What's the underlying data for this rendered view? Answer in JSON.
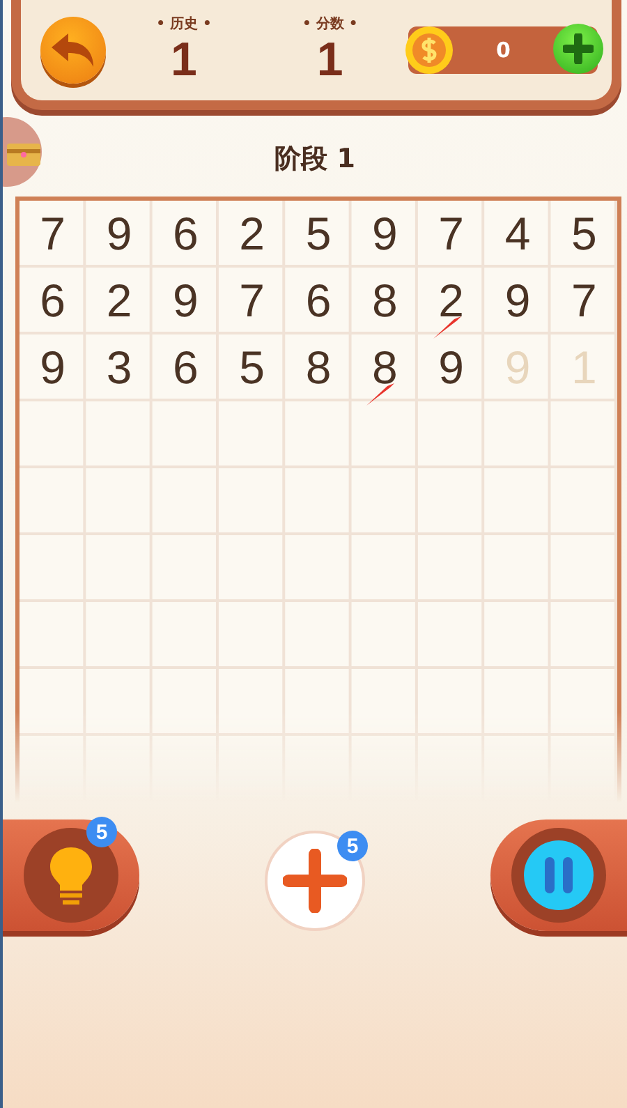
{
  "header": {
    "history": {
      "label": "• 历史 •",
      "value": "1"
    },
    "score": {
      "label": "• 分数 •",
      "value": "1"
    },
    "coins": "0"
  },
  "stage_title": "阶段 1",
  "board": {
    "cells": [
      {
        "digit": "7",
        "faded": false,
        "arrow": false
      },
      {
        "digit": "9",
        "faded": false,
        "arrow": false
      },
      {
        "digit": "6",
        "faded": false,
        "arrow": false
      },
      {
        "digit": "2",
        "faded": false,
        "arrow": false
      },
      {
        "digit": "5",
        "faded": false,
        "arrow": false
      },
      {
        "digit": "9",
        "faded": false,
        "arrow": false
      },
      {
        "digit": "7",
        "faded": false,
        "arrow": false
      },
      {
        "digit": "4",
        "faded": false,
        "arrow": false
      },
      {
        "digit": "5",
        "faded": false,
        "arrow": false
      },
      {
        "digit": "6",
        "faded": false,
        "arrow": false
      },
      {
        "digit": "2",
        "faded": false,
        "arrow": false
      },
      {
        "digit": "9",
        "faded": false,
        "arrow": false
      },
      {
        "digit": "7",
        "faded": false,
        "arrow": false
      },
      {
        "digit": "6",
        "faded": false,
        "arrow": false
      },
      {
        "digit": "8",
        "faded": false,
        "arrow": false
      },
      {
        "digit": "2",
        "faded": false,
        "arrow": true
      },
      {
        "digit": "9",
        "faded": false,
        "arrow": false
      },
      {
        "digit": "7",
        "faded": false,
        "arrow": false
      },
      {
        "digit": "9",
        "faded": false,
        "arrow": false
      },
      {
        "digit": "3",
        "faded": false,
        "arrow": false
      },
      {
        "digit": "6",
        "faded": false,
        "arrow": false
      },
      {
        "digit": "5",
        "faded": false,
        "arrow": false
      },
      {
        "digit": "8",
        "faded": false,
        "arrow": false
      },
      {
        "digit": "8",
        "faded": false,
        "arrow": true
      },
      {
        "digit": "9",
        "faded": false,
        "arrow": false
      },
      {
        "digit": "9",
        "faded": true,
        "arrow": false
      },
      {
        "digit": "1",
        "faded": true,
        "arrow": false
      }
    ]
  },
  "tools": {
    "hint_count": "5",
    "add_count": "5"
  }
}
